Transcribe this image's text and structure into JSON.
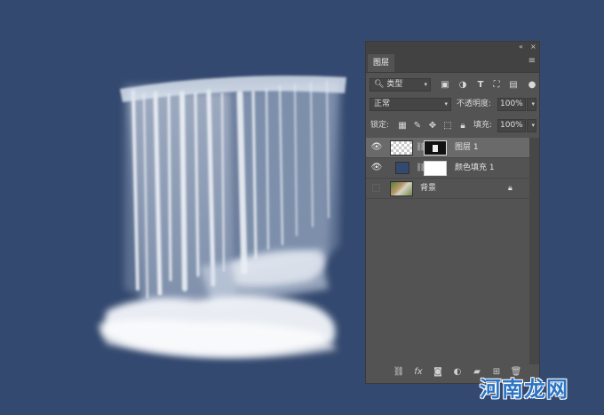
{
  "canvas": {
    "background": "#34496f"
  },
  "panel": {
    "collapse_label": "«",
    "close_label": "×",
    "tab_label": "图层",
    "menu_label": "≡",
    "filter": {
      "label": "类型",
      "icon": "search-icon"
    },
    "filter_icons": [
      "image-filter-icon",
      "adjustment-filter-icon",
      "type-filter-icon",
      "shape-filter-icon",
      "smart-object-filter-icon",
      "toggle-filter-icon"
    ],
    "blend_mode": "正常",
    "opacity_label": "不透明度:",
    "opacity_value": "100%",
    "lock_label": "锁定:",
    "lock_icons": [
      "lock-transparent-icon",
      "lock-paint-icon",
      "lock-position-icon",
      "lock-artboard-icon",
      "lock-all-icon"
    ],
    "fill_label": "填充:",
    "fill_value": "100%",
    "layers": [
      {
        "name": "图层 1",
        "visible": true,
        "selected": true,
        "has_mask": true
      },
      {
        "name": "颜色填充 1",
        "visible": true,
        "selected": false,
        "has_mask": true,
        "fill_color": "#34496f"
      },
      {
        "name": "背景",
        "visible": false,
        "selected": false,
        "locked": true
      }
    ],
    "footer_icons": [
      "link-layers-icon",
      "fx-icon",
      "add-mask-icon",
      "adjustment-layer-icon",
      "group-folder-icon",
      "new-layer-icon",
      "trash-icon"
    ]
  },
  "watermark": {
    "text": "河南龙网"
  }
}
